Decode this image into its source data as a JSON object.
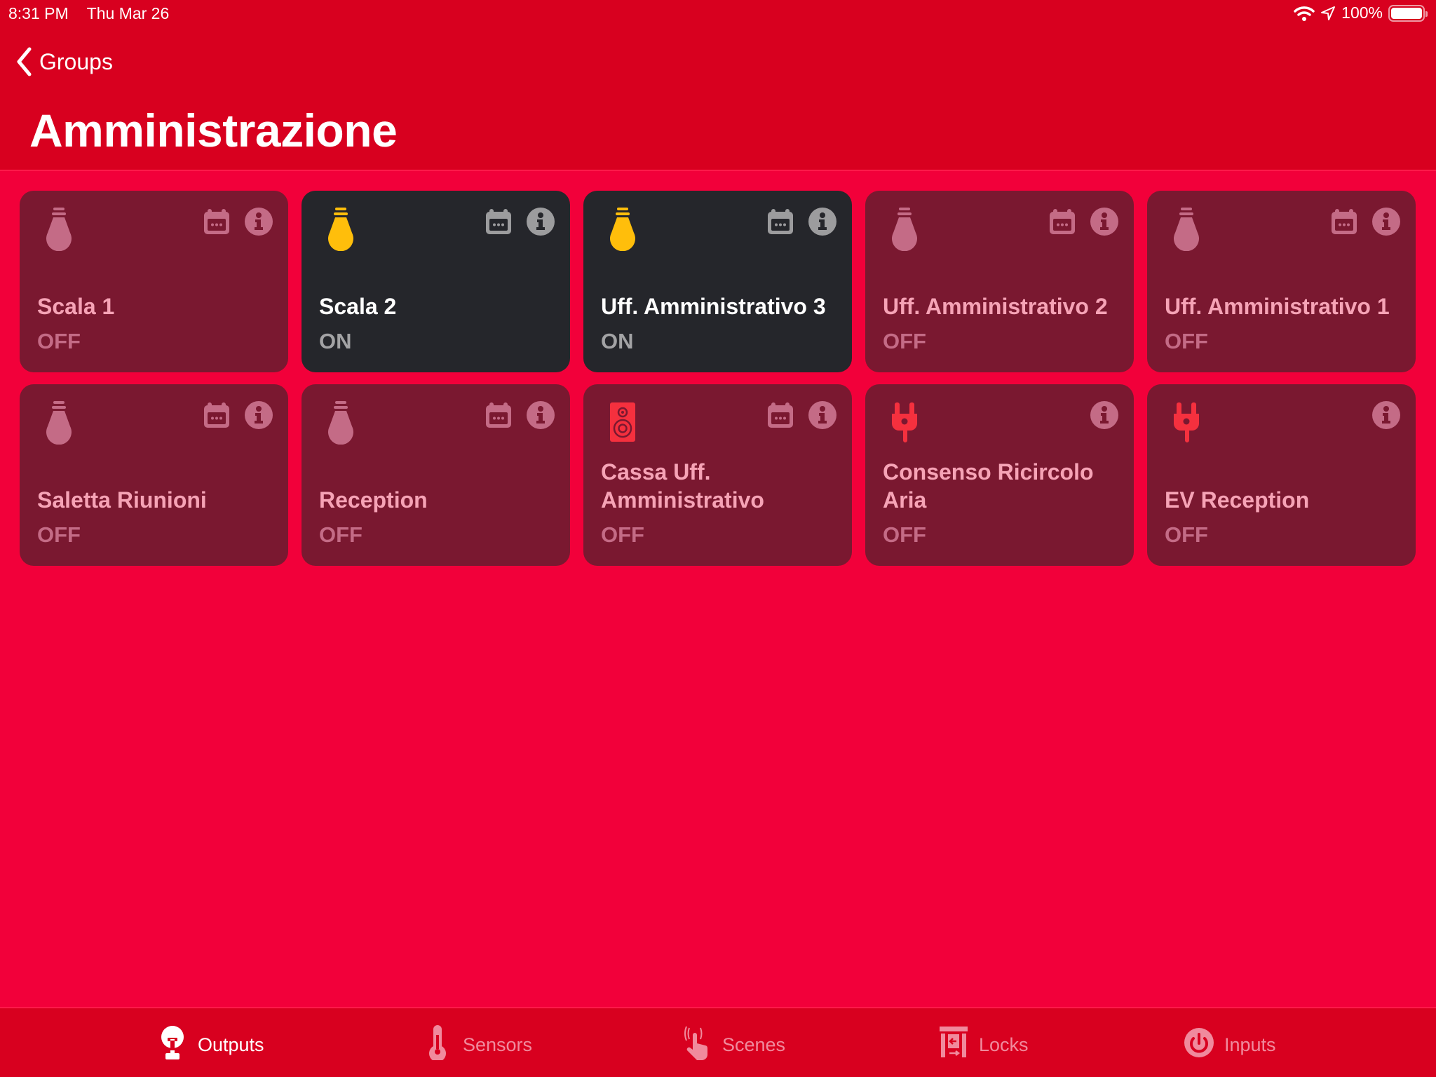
{
  "status_bar": {
    "time": "8:31 PM",
    "date": "Thu Mar 26",
    "battery": "100%",
    "battery_level": 1.0
  },
  "nav": {
    "back_label": "Groups",
    "title": "Amministrazione"
  },
  "colors": {
    "header_bg": "#d8001f",
    "content_bg": "#f2003a",
    "card_off_bg": "#7a1830",
    "card_on_bg": "#25262b",
    "bulb_on": "#ffbe0b",
    "bulb_off": "#c46b86",
    "device_accent": "#f5303e"
  },
  "outputs": [
    {
      "name": "Scala 1",
      "state": "OFF",
      "icon": "lightbulb-icon",
      "on": false,
      "schedule": true
    },
    {
      "name": "Scala 2",
      "state": "ON",
      "icon": "lightbulb-icon",
      "on": true,
      "schedule": true
    },
    {
      "name": "Uff. Amministrativo 3",
      "state": "ON",
      "icon": "lightbulb-icon",
      "on": true,
      "schedule": true
    },
    {
      "name": "Uff. Amministrativo 2",
      "state": "OFF",
      "icon": "lightbulb-icon",
      "on": false,
      "schedule": true
    },
    {
      "name": "Uff. Amministrativo 1",
      "state": "OFF",
      "icon": "lightbulb-icon",
      "on": false,
      "schedule": true
    },
    {
      "name": "Saletta Riunioni",
      "state": "OFF",
      "icon": "lightbulb-icon",
      "on": false,
      "schedule": true
    },
    {
      "name": "Reception",
      "state": "OFF",
      "icon": "lightbulb-icon",
      "on": false,
      "schedule": true
    },
    {
      "name": "Cassa Uff. Amministrativo",
      "state": "OFF",
      "icon": "speaker-icon",
      "on": false,
      "schedule": true
    },
    {
      "name": "Consenso Ricircolo Aria",
      "state": "OFF",
      "icon": "plug-icon",
      "on": false,
      "schedule": false
    },
    {
      "name": "EV Reception",
      "state": "OFF",
      "icon": "plug-icon",
      "on": false,
      "schedule": false
    }
  ],
  "tabs": [
    {
      "label": "Outputs",
      "icon": "outputs-icon",
      "active": true
    },
    {
      "label": "Sensors",
      "icon": "thermometer-icon",
      "active": false
    },
    {
      "label": "Scenes",
      "icon": "hand-tap-icon",
      "active": false
    },
    {
      "label": "Locks",
      "icon": "gate-icon",
      "active": false
    },
    {
      "label": "Inputs",
      "icon": "power-icon",
      "active": false
    }
  ]
}
